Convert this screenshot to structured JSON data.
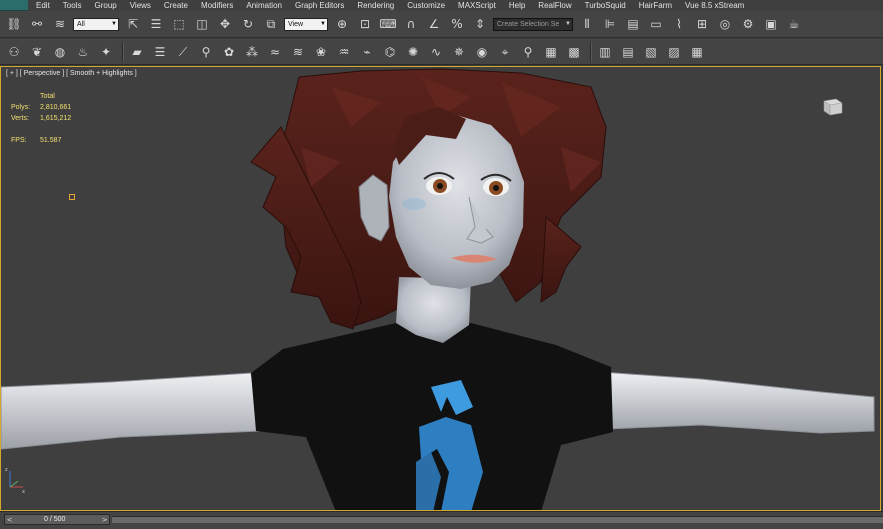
{
  "menu": {
    "items": [
      "Edit",
      "Tools",
      "Group",
      "Views",
      "Create",
      "Modifiers",
      "Animation",
      "Graph Editors",
      "Rendering",
      "Customize",
      "MAXScript",
      "Help",
      "RealFlow",
      "TurboSquid",
      "HairFarm",
      "Vue 8.5 xStream"
    ]
  },
  "toolbar": {
    "selection_filter": "All",
    "reference_coord": "View",
    "named_selection_placeholder": "Create Selection Se",
    "main_icons": [
      "link-icon",
      "unlink-icon",
      "bind-spacewarp-icon",
      "select-object-icon",
      "select-by-name-icon",
      "rectangular-selection-icon",
      "window-crossing-icon",
      "select-move-icon",
      "select-rotate-icon",
      "select-scale-icon",
      "pivot-center-icon",
      "select-manipulate-icon",
      "keyboard-shortcut-icon",
      "snap-toggle-icon",
      "angle-snap-icon",
      "percent-snap-icon",
      "spinner-snap-icon",
      "edit-named-selection-icon",
      "mirror-icon",
      "align-icon",
      "layer-manager-icon",
      "graphite-ribbon-icon",
      "curve-editor-icon",
      "schematic-view-icon",
      "material-editor-icon",
      "render-setup-icon",
      "rendered-frame-icon",
      "render-production-icon",
      "environment-icon"
    ],
    "secondary_icons": [
      "plugin-a-icon",
      "plugin-b-icon",
      "plugin-c-icon",
      "plugin-d-icon",
      "plugin-e-icon",
      "plugin-f-icon",
      "plugin-g-icon",
      "plugin-h-icon",
      "plugin-i-icon",
      "plugin-j-icon",
      "plugin-k-icon",
      "plugin-l-icon",
      "plugin-m-icon",
      "plugin-n-icon",
      "plugin-o-icon",
      "plugin-p-icon",
      "plugin-q-icon",
      "plugin-r-icon",
      "plugin-s-icon",
      "plugin-t-icon",
      "plugin-u-icon",
      "plugin-v-icon",
      "plugin-w-icon",
      "plugin-x-icon",
      "plugin-y-icon",
      "plugin-z-icon",
      "plugin-aa-icon",
      "plugin-ab-icon",
      "plugin-ac-icon",
      "plugin-ad-icon",
      "plugin-ae-icon",
      "plugin-af-icon"
    ]
  },
  "viewport": {
    "label": "[ + ] [ Perspective ] [ Smooth + Highlights ]",
    "border_color": "#d3a92d",
    "background": "#3f3f3f"
  },
  "stats": {
    "header": "Total",
    "polys_label": "Polys:",
    "polys_value": "2,810,661",
    "verts_label": "Verts:",
    "verts_value": "1,615,212",
    "fps_label": "FPS:",
    "fps_value": "51.587",
    "text_color": "#f2e070"
  },
  "timeline": {
    "readout": "0 / 500",
    "left_arrow": "<",
    "right_arrow": ">"
  },
  "colors": {
    "ui_background": "#444444",
    "menu_background": "#3f3f3f",
    "hair": "#4a1d17",
    "skin": "#c8ccd3",
    "shirt": "#111111",
    "shirt_logo": "#2e7fc2"
  }
}
